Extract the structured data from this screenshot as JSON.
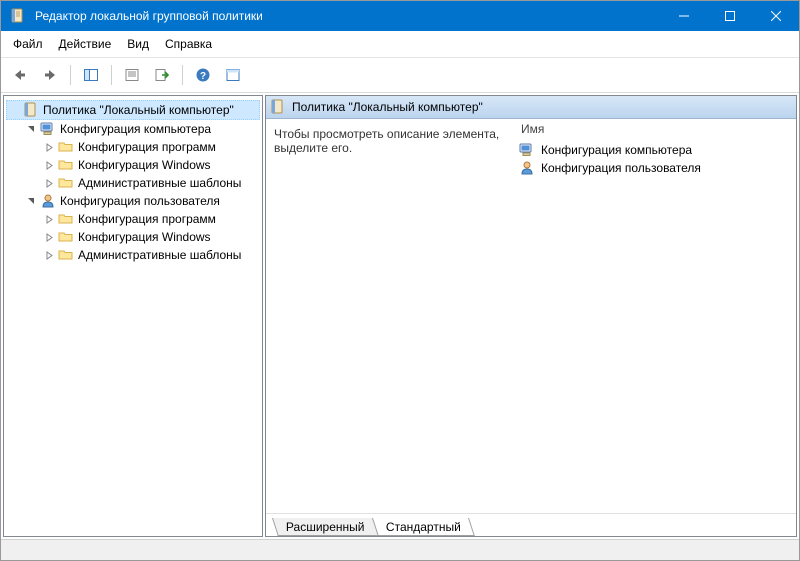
{
  "window": {
    "title": "Редактор локальной групповой политики"
  },
  "menu": {
    "file": "Файл",
    "action": "Действие",
    "view": "Вид",
    "help": "Справка"
  },
  "tree": {
    "root": "Политика \"Локальный компьютер\"",
    "computer": "Конфигурация компьютера",
    "user": "Конфигурация пользователя",
    "software": "Конфигурация программ",
    "windows": "Конфигурация Windows",
    "admin": "Административные шаблоны"
  },
  "right": {
    "header": "Политика \"Локальный компьютер\"",
    "description": "Чтобы просмотреть описание элемента, выделите его.",
    "column_name": "Имя",
    "items": {
      "computer": "Конфигурация компьютера",
      "user": "Конфигурация пользователя"
    }
  },
  "tabs": {
    "extended": "Расширенный",
    "standard": "Стандартный"
  }
}
